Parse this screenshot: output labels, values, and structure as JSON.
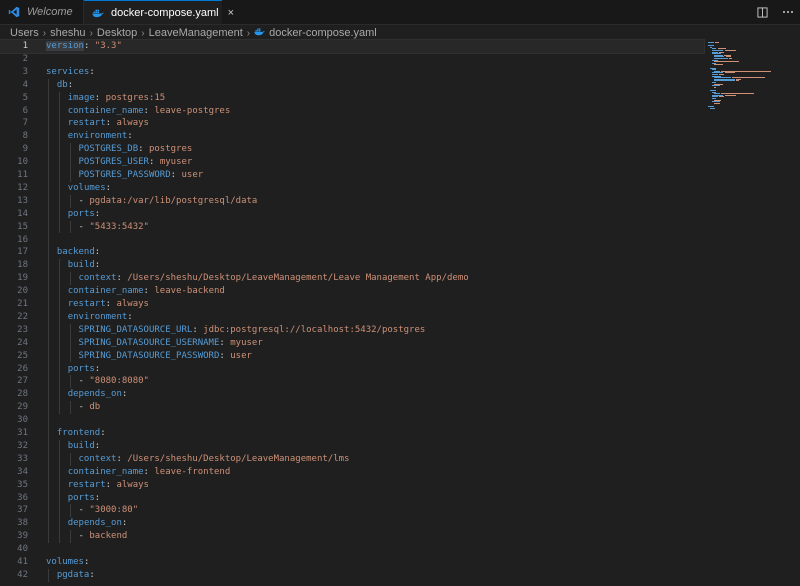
{
  "tabs": [
    {
      "label": "Welcome",
      "icon": "vscode-icon",
      "active": false
    },
    {
      "label": "docker-compose.yaml",
      "icon": "docker-icon",
      "active": true,
      "close": "×"
    }
  ],
  "breadcrumb": [
    "Users",
    "sheshu",
    "Desktop",
    "LeaveManagement",
    "docker-compose.yaml"
  ],
  "editor": {
    "current_line": 1,
    "lines": [
      {
        "n": "1",
        "indent": 0,
        "key": "version",
        "val": "\"3.3\""
      },
      {
        "n": "2",
        "indent": 0
      },
      {
        "n": "3",
        "indent": 0,
        "key": "services",
        "val": ""
      },
      {
        "n": "4",
        "indent": 1,
        "key": "db",
        "val": ""
      },
      {
        "n": "5",
        "indent": 2,
        "key": "image",
        "val": "postgres:15"
      },
      {
        "n": "6",
        "indent": 2,
        "key": "container_name",
        "val": "leave-postgres"
      },
      {
        "n": "7",
        "indent": 2,
        "key": "restart",
        "val": "always"
      },
      {
        "n": "8",
        "indent": 2,
        "key": "environment",
        "val": ""
      },
      {
        "n": "9",
        "indent": 3,
        "key": "POSTGRES_DB",
        "val": "postgres"
      },
      {
        "n": "10",
        "indent": 3,
        "key": "POSTGRES_USER",
        "val": "myuser"
      },
      {
        "n": "11",
        "indent": 3,
        "key": "POSTGRES_PASSWORD",
        "val": "user"
      },
      {
        "n": "12",
        "indent": 2,
        "key": "volumes",
        "val": ""
      },
      {
        "n": "13",
        "indent": 3,
        "item": "pgdata:/var/lib/postgresql/data"
      },
      {
        "n": "14",
        "indent": 2,
        "key": "ports",
        "val": ""
      },
      {
        "n": "15",
        "indent": 3,
        "item": "\"5433:5432\""
      },
      {
        "n": "16",
        "indent": 0
      },
      {
        "n": "17",
        "indent": 1,
        "key": "backend",
        "val": ""
      },
      {
        "n": "18",
        "indent": 2,
        "key": "build",
        "val": ""
      },
      {
        "n": "19",
        "indent": 3,
        "key": "context",
        "val": "/Users/sheshu/Desktop/LeaveManagement/Leave Management App/demo"
      },
      {
        "n": "20",
        "indent": 2,
        "key": "container_name",
        "val": "leave-backend"
      },
      {
        "n": "21",
        "indent": 2,
        "key": "restart",
        "val": "always"
      },
      {
        "n": "22",
        "indent": 2,
        "key": "environment",
        "val": ""
      },
      {
        "n": "23",
        "indent": 3,
        "key": "SPRING_DATASOURCE_URL",
        "val": "jdbc:postgresql://localhost:5432/postgres"
      },
      {
        "n": "24",
        "indent": 3,
        "key": "SPRING_DATASOURCE_USERNAME",
        "val": "myuser"
      },
      {
        "n": "25",
        "indent": 3,
        "key": "SPRING_DATASOURCE_PASSWORD",
        "val": "user"
      },
      {
        "n": "26",
        "indent": 2,
        "key": "ports",
        "val": ""
      },
      {
        "n": "27",
        "indent": 3,
        "item": "\"8080:8080\""
      },
      {
        "n": "28",
        "indent": 2,
        "key": "depends_on",
        "val": ""
      },
      {
        "n": "29",
        "indent": 3,
        "item": "db"
      },
      {
        "n": "30",
        "indent": 0
      },
      {
        "n": "31",
        "indent": 1,
        "key": "frontend",
        "val": ""
      },
      {
        "n": "32",
        "indent": 2,
        "key": "build",
        "val": ""
      },
      {
        "n": "33",
        "indent": 3,
        "key": "context",
        "val": "/Users/sheshu/Desktop/LeaveManagement/lms"
      },
      {
        "n": "34",
        "indent": 2,
        "key": "container_name",
        "val": "leave-frontend"
      },
      {
        "n": "35",
        "indent": 2,
        "key": "restart",
        "val": "always"
      },
      {
        "n": "36",
        "indent": 2,
        "key": "ports",
        "val": ""
      },
      {
        "n": "37",
        "indent": 3,
        "item": "\"3000:80\""
      },
      {
        "n": "38",
        "indent": 2,
        "key": "depends_on",
        "val": ""
      },
      {
        "n": "39",
        "indent": 3,
        "item": "backend"
      },
      {
        "n": "40",
        "indent": 0
      },
      {
        "n": "41",
        "indent": 0,
        "key": "volumes",
        "val": ""
      },
      {
        "n": "42",
        "indent": 1,
        "key": "pgdata",
        "val": ""
      }
    ]
  },
  "colors": {
    "key": "#569cd6",
    "value": "#ce9178",
    "accent": "#0078d4",
    "docker": "#2496ed"
  }
}
